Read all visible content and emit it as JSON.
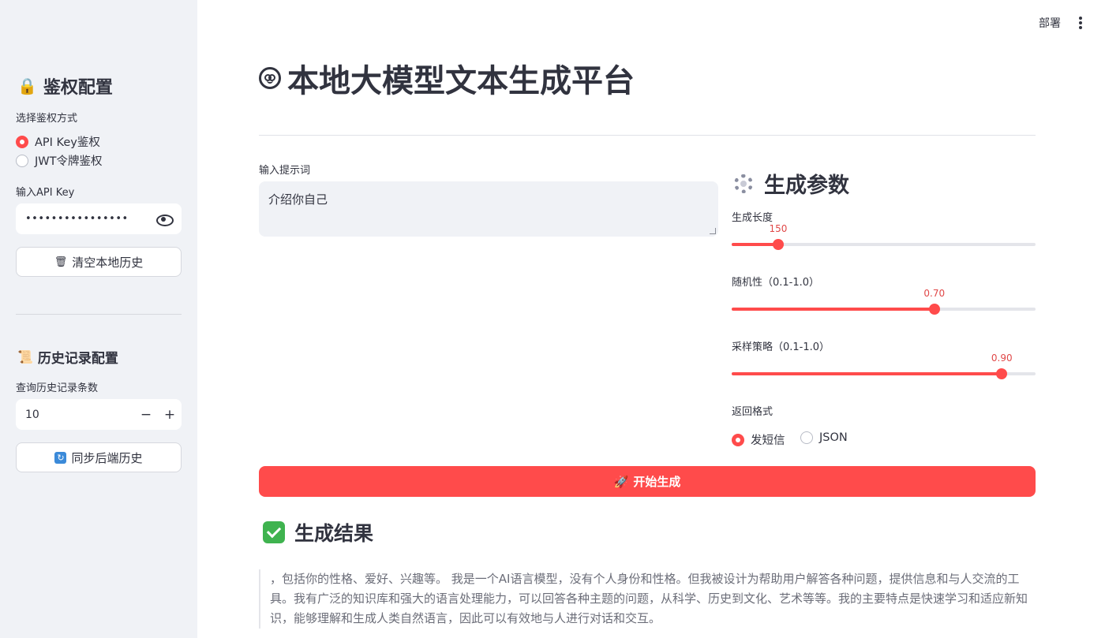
{
  "sidebar": {
    "auth_title": "鉴权配置",
    "auth_method_label": "选择鉴权方式",
    "auth_options": [
      "API Key鉴权",
      "JWT令牌鉴权"
    ],
    "auth_selected_index": 0,
    "api_key_label": "输入API Key",
    "api_key_value": "••••••••••••••••",
    "clear_history_label": "清空本地历史",
    "history_title": "历史记录配置",
    "history_count_label": "查询历史记录条数",
    "history_count_value": "10",
    "decrement_label": "−",
    "increment_label": "+",
    "sync_history_label": "同步后端历史"
  },
  "topbar": {
    "deploy_label": "部署"
  },
  "main": {
    "title": "本地大模型文本生成平台",
    "prompt_label": "输入提示词",
    "prompt_value": "介绍你自己",
    "params_title": "生成参数",
    "sliders": [
      {
        "label": "生成长度",
        "value_text": "150",
        "fraction": 0.153
      },
      {
        "label": "随机性（0.1-1.0）",
        "value_text": "0.70",
        "fraction": 0.667
      },
      {
        "label": "采样策略（0.1-1.0）",
        "value_text": "0.90",
        "fraction": 0.889
      }
    ],
    "format_label": "返回格式",
    "format_options": [
      "发短信",
      "JSON"
    ],
    "format_selected_index": 0,
    "generate_label": "开始生成",
    "result_title": "生成结果",
    "result_text": "，包括你的性格、爱好、兴趣等。 我是一个AI语言模型，没有个人身份和性格。但我被设计为帮助用户解答各种问题，提供信息和与人交流的工具。我有广泛的知识库和强大的语言处理能力，可以回答各种主题的问题，从科学、历史到文化、艺术等等。我的主要特点是快速学习和适应新知识，能够理解和生成人类自然语言，因此可以有效地与人进行对话和交互。"
  },
  "colors": {
    "accent": "#ff4b4b",
    "sidebar_bg": "#f0f2f6",
    "text": "#31333f",
    "success": "#3fb34f"
  },
  "icons": {
    "auth": "lock-icon",
    "clear": "wastebasket-icon",
    "history": "scroll-icon",
    "sync": "sync-icon",
    "title": "robot-face-icon",
    "params": "gear-icon",
    "generate": "rocket-icon",
    "result": "check-mark-icon"
  }
}
